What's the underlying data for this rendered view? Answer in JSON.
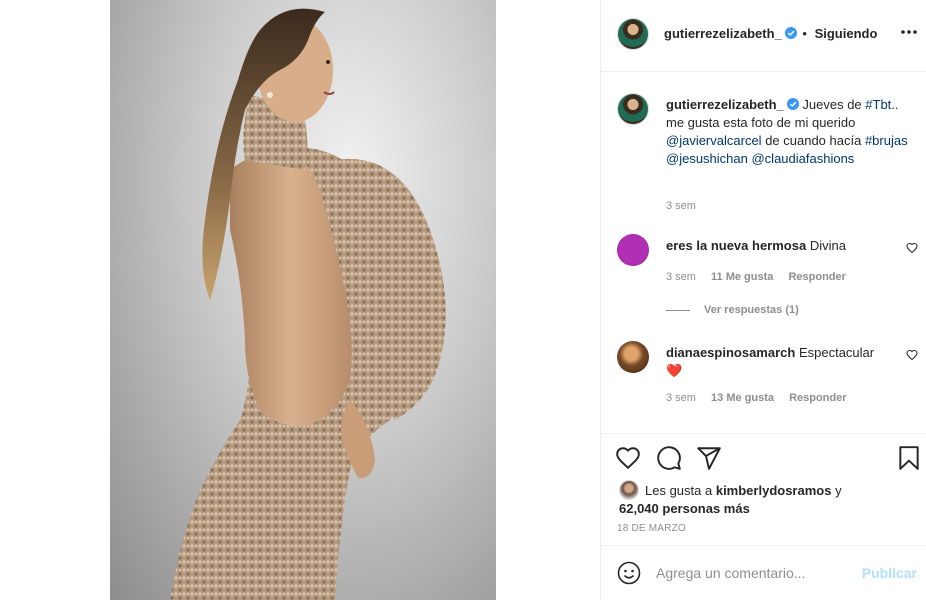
{
  "post": {
    "username": "gutierrezelizabeth_",
    "follow_state": "Siguiendo",
    "separator": "•",
    "caption": {
      "username": "gutierrezelizabeth_",
      "text_1": "Jueves de",
      "tag_1": "#Tbt",
      "text_2": ".. me gusta esta foto de mi querido",
      "mention_1": "@javiervalcarcel",
      "text_3": "de cuando hacía",
      "tag_2": "#brujas",
      "mention_2": "@jesushichan",
      "mention_3": "@claudiafashions",
      "time": "3 sem"
    }
  },
  "comments": [
    {
      "username": "eres la nueva hermosa",
      "text": "Divina",
      "time": "3 sem",
      "likes": "11 Me gusta",
      "reply": "Responder",
      "replies_label": "Ver respuestas (1)"
    },
    {
      "username": "dianaespinosamarch",
      "text": "Espectacular",
      "emoji": "❤️",
      "time": "3 sem",
      "likes": "13 Me gusta",
      "reply": "Responder"
    }
  ],
  "actions": {
    "liked_by_prefix": "Les gusta a",
    "liked_by_user": "kimberlydosramos",
    "liked_by_joiner": "y",
    "liked_by_count": "62,040 personas más",
    "date": "18 DE MARZO"
  },
  "add_comment": {
    "placeholder": "Agrega un comentario...",
    "publish": "Publicar"
  },
  "colors": {
    "link": "#00376b",
    "verified": "#3897f0",
    "publish_disabled": "#b2dffc",
    "heart_red": "#ed4956"
  },
  "icons": [
    "verified-icon",
    "more-options-icon",
    "heart-icon",
    "comment-icon",
    "share-icon",
    "bookmark-icon",
    "emoji-icon"
  ]
}
